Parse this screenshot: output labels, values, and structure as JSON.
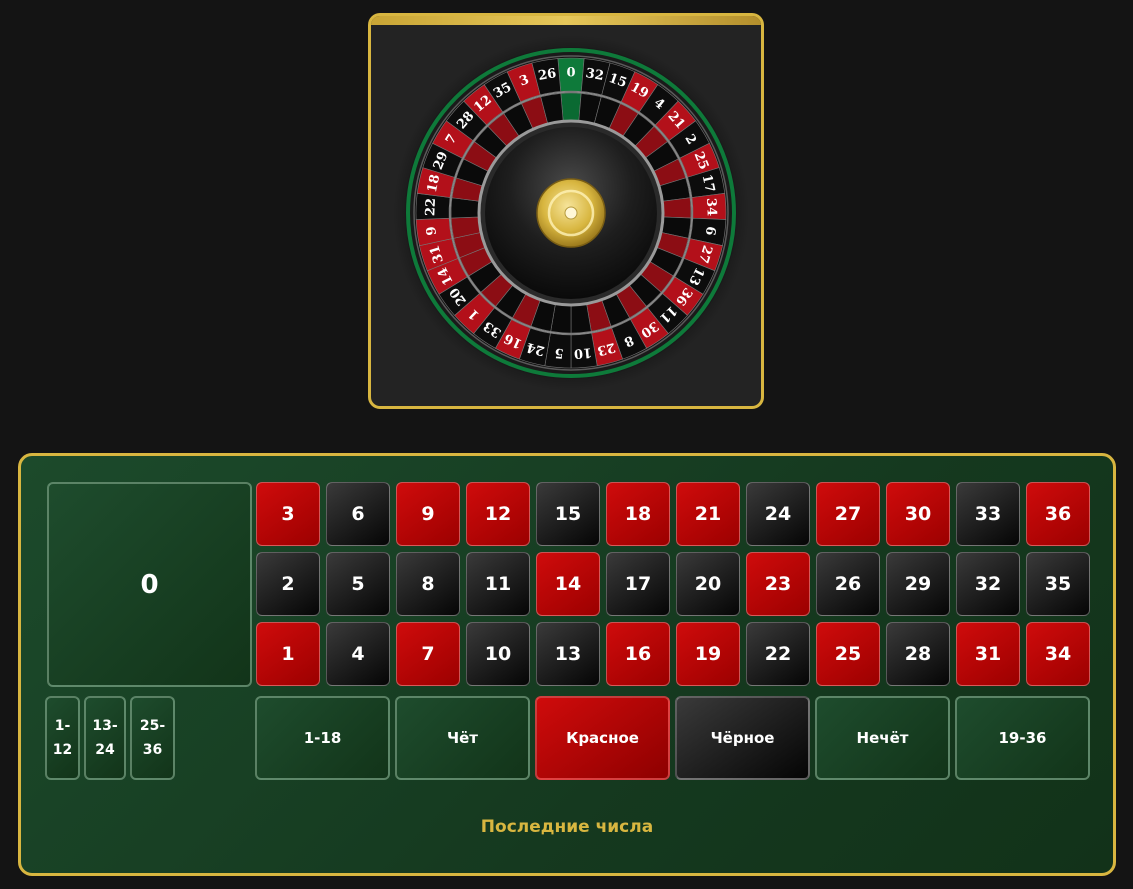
{
  "wheel": {
    "sequence": [
      0,
      32,
      15,
      19,
      4,
      21,
      2,
      25,
      17,
      34,
      6,
      27,
      13,
      36,
      11,
      30,
      8,
      23,
      10,
      5,
      24,
      16,
      33,
      1,
      20,
      14,
      31,
      9,
      22,
      18,
      29,
      7,
      28,
      12,
      35,
      3,
      26
    ],
    "colors": {
      "red": "#b3101a",
      "black": "#0c0c0c",
      "green": "#0e7a3a",
      "gold": "#d8b640"
    }
  },
  "table": {
    "zero": "0",
    "rows": [
      [
        {
          "n": "3",
          "c": "red"
        },
        {
          "n": "6",
          "c": "black"
        },
        {
          "n": "9",
          "c": "red"
        },
        {
          "n": "12",
          "c": "red"
        },
        {
          "n": "15",
          "c": "black"
        },
        {
          "n": "18",
          "c": "red"
        },
        {
          "n": "21",
          "c": "red"
        },
        {
          "n": "24",
          "c": "black"
        },
        {
          "n": "27",
          "c": "red"
        },
        {
          "n": "30",
          "c": "red"
        },
        {
          "n": "33",
          "c": "black"
        },
        {
          "n": "36",
          "c": "red"
        }
      ],
      [
        {
          "n": "2",
          "c": "black"
        },
        {
          "n": "5",
          "c": "black"
        },
        {
          "n": "8",
          "c": "black"
        },
        {
          "n": "11",
          "c": "black"
        },
        {
          "n": "14",
          "c": "red"
        },
        {
          "n": "17",
          "c": "black"
        },
        {
          "n": "20",
          "c": "black"
        },
        {
          "n": "23",
          "c": "red"
        },
        {
          "n": "26",
          "c": "black"
        },
        {
          "n": "29",
          "c": "black"
        },
        {
          "n": "32",
          "c": "black"
        },
        {
          "n": "35",
          "c": "black"
        }
      ],
      [
        {
          "n": "1",
          "c": "red"
        },
        {
          "n": "4",
          "c": "black"
        },
        {
          "n": "7",
          "c": "red"
        },
        {
          "n": "10",
          "c": "black"
        },
        {
          "n": "13",
          "c": "black"
        },
        {
          "n": "16",
          "c": "red"
        },
        {
          "n": "19",
          "c": "red"
        },
        {
          "n": "22",
          "c": "black"
        },
        {
          "n": "25",
          "c": "red"
        },
        {
          "n": "28",
          "c": "black"
        },
        {
          "n": "31",
          "c": "red"
        },
        {
          "n": "34",
          "c": "red"
        }
      ]
    ],
    "dozens": [
      {
        "line1": "1-",
        "line2": "12"
      },
      {
        "line1": "13-",
        "line2": "24"
      },
      {
        "line1": "25-",
        "line2": "36"
      }
    ],
    "outside": [
      {
        "label": "1-18",
        "style": "green"
      },
      {
        "label": "Чёт",
        "style": "green"
      },
      {
        "label": "Красное",
        "style": "red"
      },
      {
        "label": "Чёрное",
        "style": "black"
      },
      {
        "label": "Нечёт",
        "style": "green"
      },
      {
        "label": "19-36",
        "style": "green"
      }
    ]
  },
  "last_numbers": {
    "title": "Последние числа"
  }
}
